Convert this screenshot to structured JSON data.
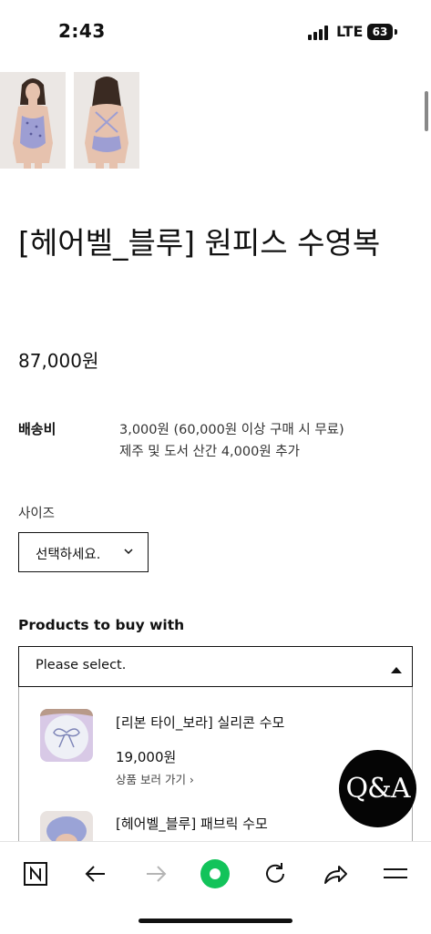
{
  "status_bar": {
    "time": "2:43",
    "network": "LTE",
    "battery": "63"
  },
  "product": {
    "title": "[헤어벨_블루] 원피스 수영복",
    "price": "87,000원"
  },
  "shipping": {
    "label": "배송비",
    "line1": "3,000원 (60,000원 이상 구매 시 무료)",
    "line2": "제주 및 도서 산간 4,000원 추가"
  },
  "size": {
    "label": "사이즈",
    "selected": "선택하세요."
  },
  "buy_with": {
    "title": "Products to buy with",
    "selected": "Please select.",
    "items": [
      {
        "name": "[리본 타이_보라] 실리콘 수모",
        "price": "19,000원",
        "link": "상품 보러 가기 ›"
      },
      {
        "name": "[헤어벨_블루] 패브릭 수모"
      }
    ]
  },
  "qa_badge": {
    "label": "Q&A"
  },
  "colors": {
    "accent_green": "#12c35a",
    "text": "#111111"
  },
  "browser_bar": {
    "icons": [
      "naver-n-icon",
      "back-arrow-icon",
      "forward-arrow-icon",
      "green-home-dot-icon",
      "refresh-icon",
      "share-icon",
      "menu-icon"
    ]
  }
}
